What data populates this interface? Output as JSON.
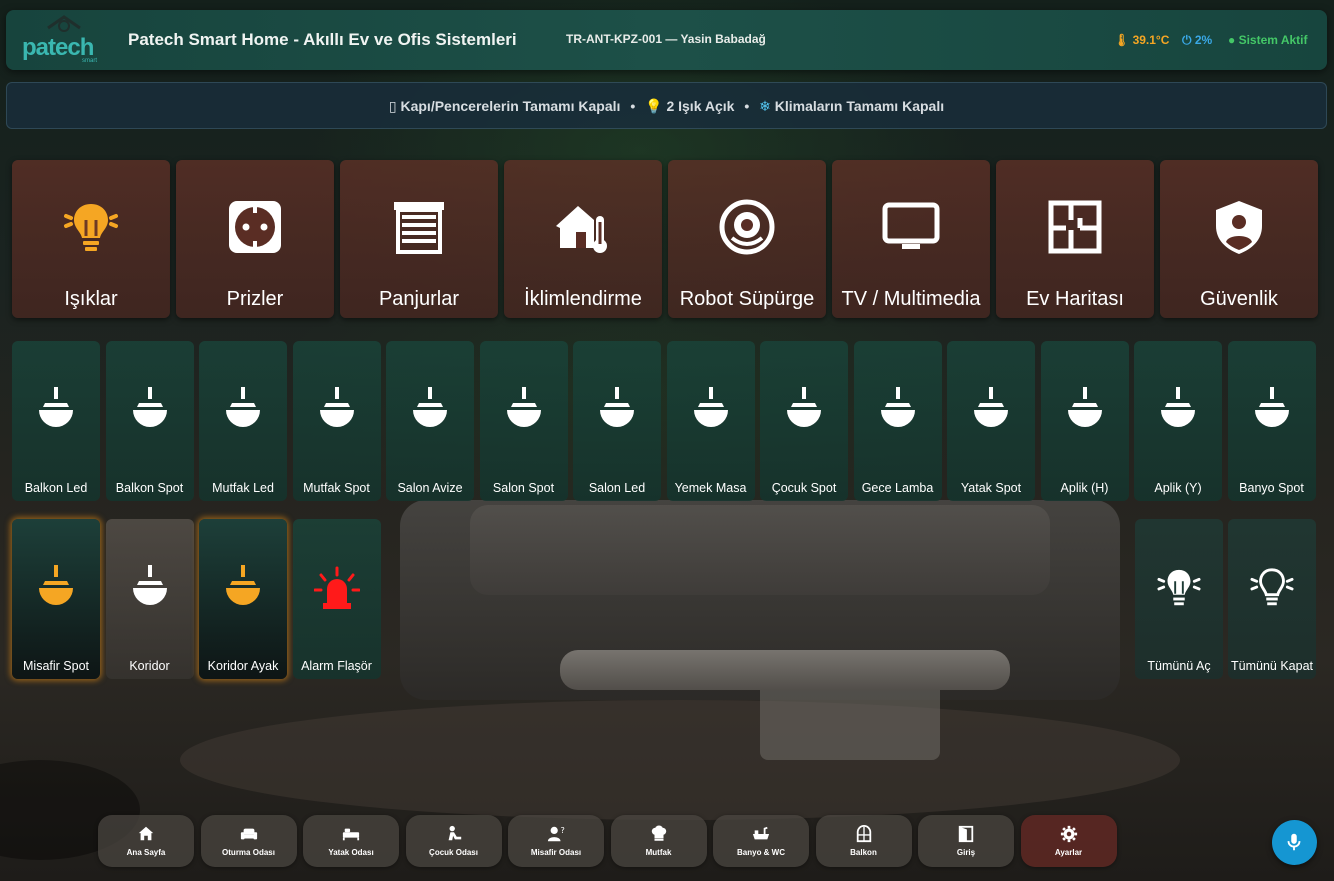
{
  "header": {
    "logo_text": "patech",
    "logo_sub": "smart",
    "title": "Patech Smart Home - Akıllı Ev ve Ofis Sistemleri",
    "device_id": "TR-ANT-KPZ-001 — Yasin Babadağ",
    "temperature": "39.1°C",
    "power": "2%",
    "system_status": "Sistem Aktif",
    "colors": {
      "temperature": "#f5a623",
      "power": "#3aa9e8",
      "system": "#44c767"
    }
  },
  "status_bar": {
    "doors": "Kapı/Pencerelerin Tamamı Kapalı",
    "lights": "2 Işık Açık",
    "climate": "Klimaların Tamamı Kapalı",
    "separator": "•"
  },
  "categories": [
    {
      "label": "Işıklar",
      "icon": "light-bulb-icon",
      "icon_color": "#f5a623"
    },
    {
      "label": "Prizler",
      "icon": "socket-icon",
      "icon_color": "#ffffff"
    },
    {
      "label": "Panjurlar",
      "icon": "shutter-icon",
      "icon_color": "#ffffff"
    },
    {
      "label": "İklimlendirme",
      "icon": "home-thermometer-icon",
      "icon_color": "#ffffff"
    },
    {
      "label": "Robot Süpürge",
      "icon": "robot-vacuum-icon",
      "icon_color": "#ffffff"
    },
    {
      "label": "TV / Multimedia",
      "icon": "tv-icon",
      "icon_color": "#ffffff"
    },
    {
      "label": "Ev Haritası",
      "icon": "floor-plan-icon",
      "icon_color": "#ffffff"
    },
    {
      "label": "Güvenlik",
      "icon": "security-shield-icon",
      "icon_color": "#ffffff"
    }
  ],
  "lights_row1": [
    {
      "label": "Balkon Led",
      "state": "off"
    },
    {
      "label": "Balkon Spot",
      "state": "off"
    },
    {
      "label": "Mutfak Led",
      "state": "off"
    },
    {
      "label": "Mutfak Spot",
      "state": "off"
    },
    {
      "label": "Salon Avize",
      "state": "off"
    },
    {
      "label": "Salon Spot",
      "state": "off"
    },
    {
      "label": "Salon Led",
      "state": "off"
    },
    {
      "label": "Yemek Masa",
      "state": "off"
    },
    {
      "label": "Çocuk Spot",
      "state": "off"
    },
    {
      "label": "Gece Lamba",
      "state": "off"
    },
    {
      "label": "Yatak Spot",
      "state": "off"
    },
    {
      "label": "Aplik (H)",
      "state": "off"
    },
    {
      "label": "Aplik (Y)",
      "state": "off"
    },
    {
      "label": "Banyo Spot",
      "state": "off"
    }
  ],
  "lights_row2": [
    {
      "label": "Misafir Spot",
      "state": "on"
    },
    {
      "label": "Koridor",
      "state": "off"
    },
    {
      "label": "Koridor Ayak",
      "state": "on"
    },
    {
      "label": "Alarm Flaşör",
      "state": "alarm"
    }
  ],
  "bulk_actions": [
    {
      "label": "Tümünü Aç",
      "icon": "all-lights-on-icon"
    },
    {
      "label": "Tümünü Kapat",
      "icon": "all-lights-off-icon"
    }
  ],
  "nav": [
    {
      "label": "Ana Sayfa",
      "icon": "home-icon"
    },
    {
      "label": "Oturma Odası",
      "icon": "sofa-icon"
    },
    {
      "label": "Yatak Odası",
      "icon": "bed-icon"
    },
    {
      "label": "Çocuk Odası",
      "icon": "child-icon"
    },
    {
      "label": "Misafir Odası",
      "icon": "guest-icon"
    },
    {
      "label": "Mutfak",
      "icon": "chef-hat-icon"
    },
    {
      "label": "Banyo & WC",
      "icon": "bath-icon"
    },
    {
      "label": "Balkon",
      "icon": "balcony-door-icon"
    },
    {
      "label": "Giriş",
      "icon": "entrance-door-icon"
    },
    {
      "label": "Ayarlar",
      "icon": "gear-icon",
      "active": true
    }
  ],
  "mic": {
    "icon": "microphone-icon"
  },
  "colors": {
    "light_on": "#f5a623",
    "light_off": "#ffffff",
    "alarm": "#ff1a1a",
    "accent": "#1596d2"
  }
}
